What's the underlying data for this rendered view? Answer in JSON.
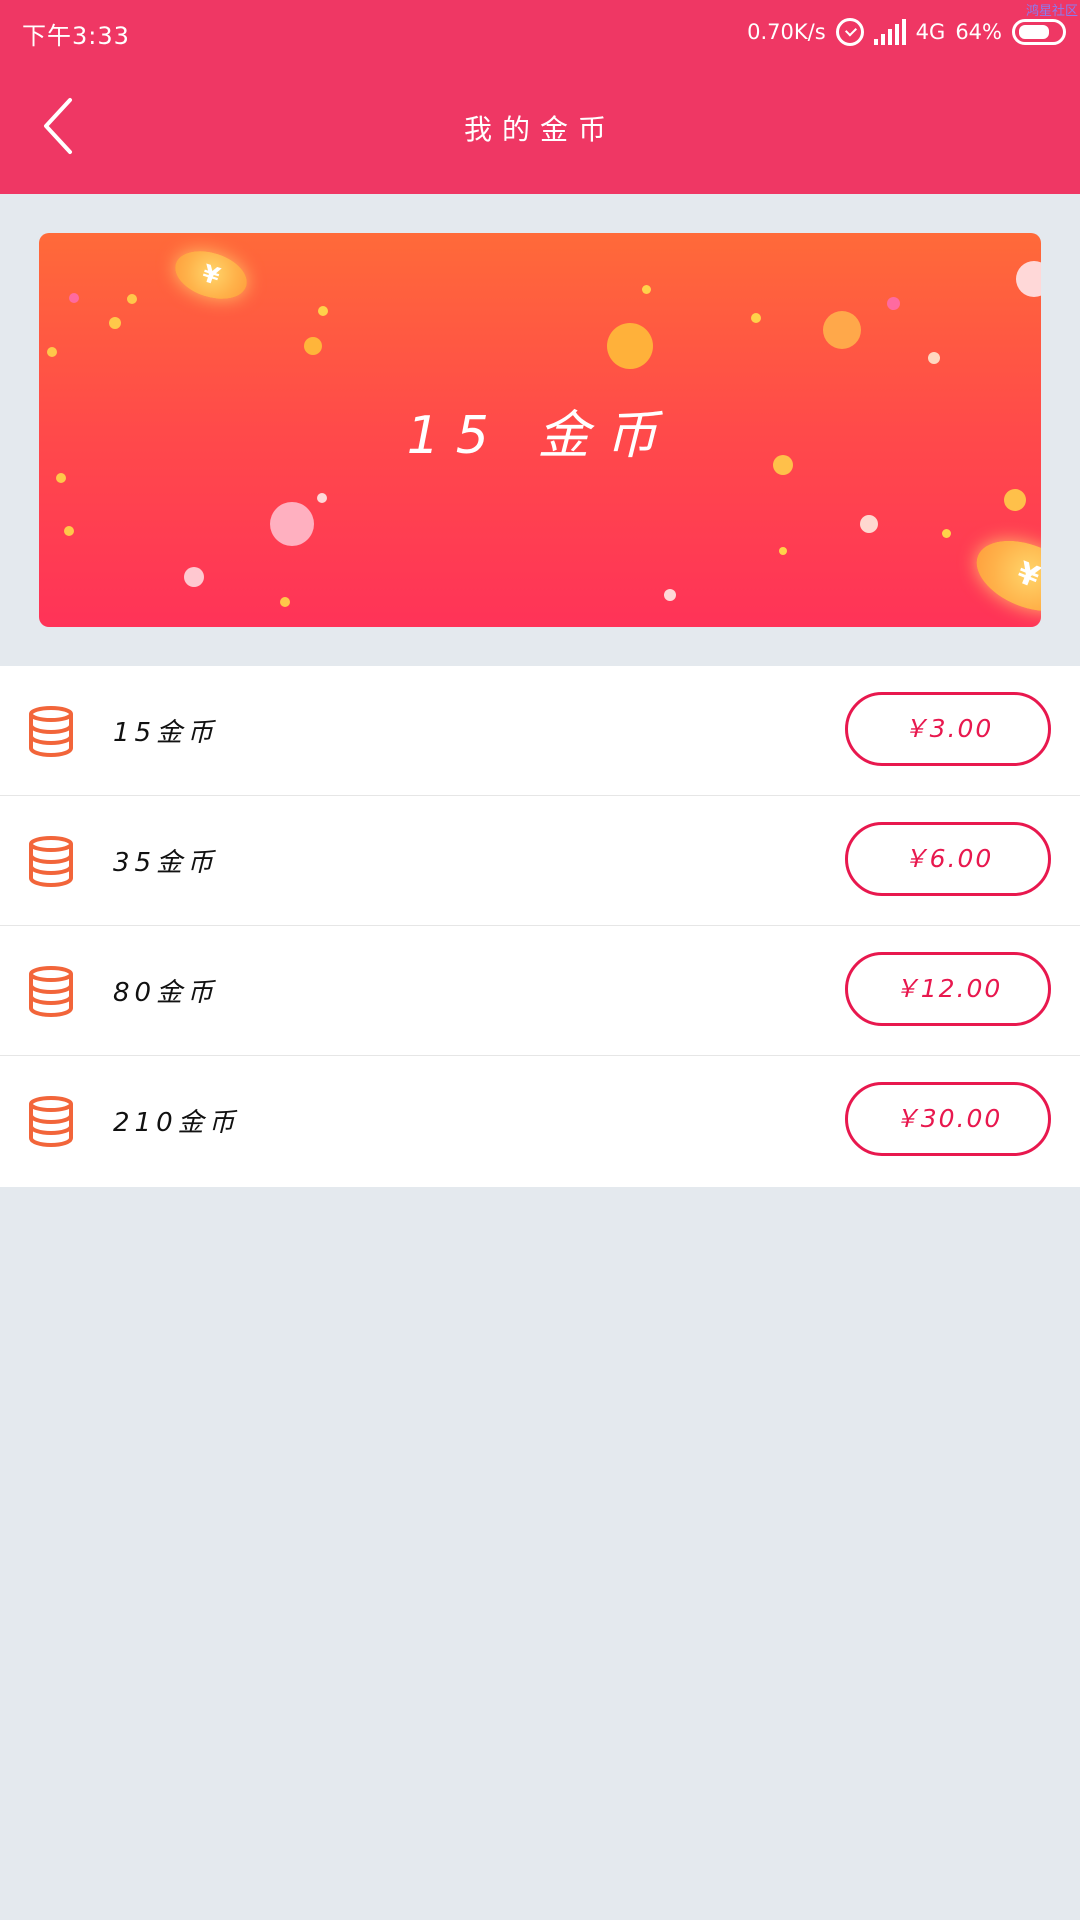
{
  "status_bar": {
    "time": "下午3:33",
    "net_speed": "0.70K/s",
    "network": "4G",
    "battery": "64%",
    "watermark": "鸿星社区"
  },
  "header": {
    "title": "我的金币"
  },
  "banner": {
    "text": "15 金币"
  },
  "items": [
    {
      "label": "15金币",
      "price": "￥3.00"
    },
    {
      "label": "35金币",
      "price": "￥6.00"
    },
    {
      "label": "80金币",
      "price": "￥12.00"
    },
    {
      "label": "210金币",
      "price": "￥30.00"
    }
  ],
  "colors": {
    "header": "#ef3764",
    "accent": "#e8184e",
    "coin_icon": "#f2653a",
    "background": "#e4e9ee"
  }
}
